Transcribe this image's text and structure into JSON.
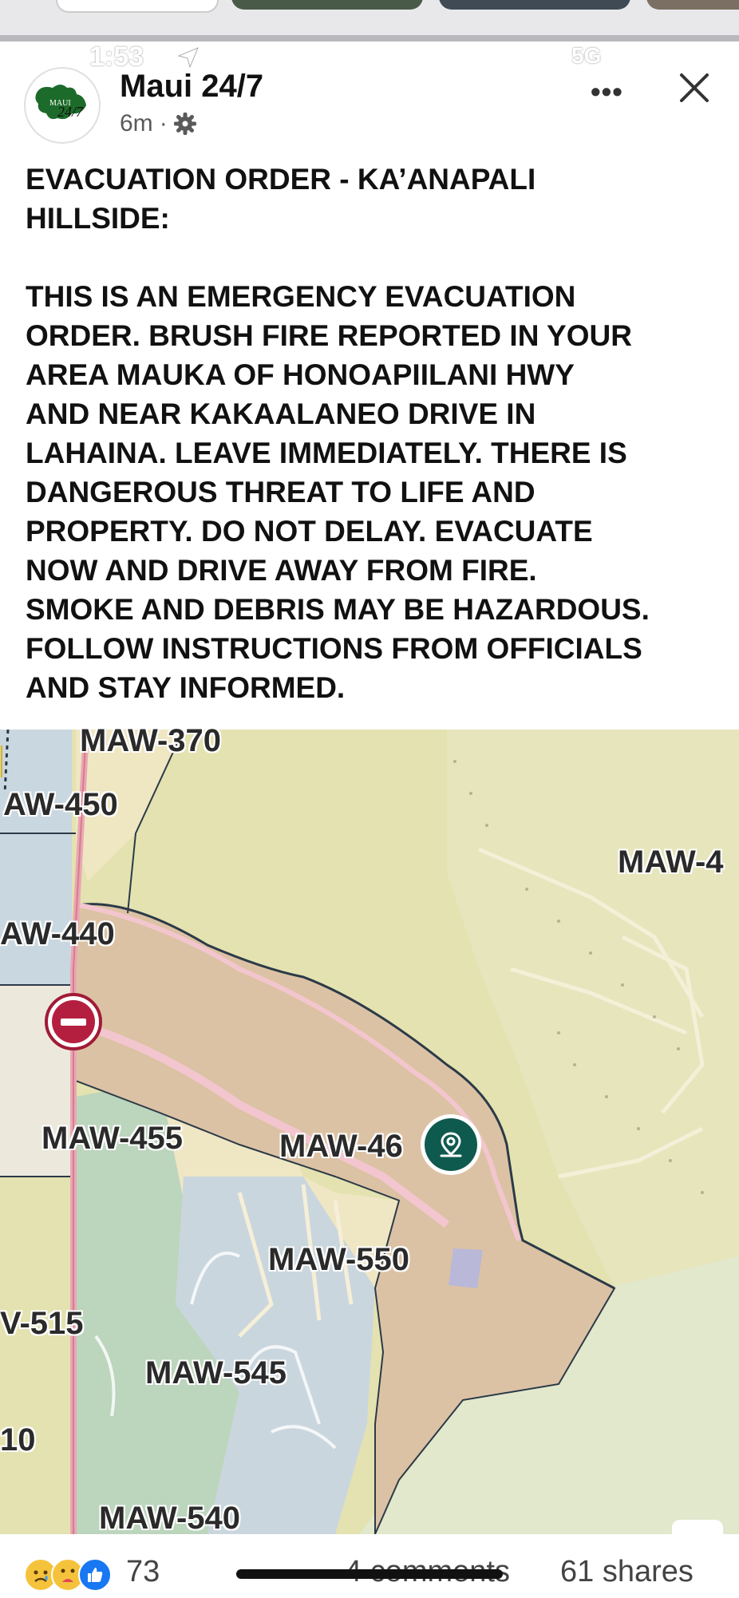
{
  "status_bar": {
    "time": "1:53",
    "network": "5G"
  },
  "post": {
    "page_name": "Maui 24/7",
    "avatar_text_top": "MAUI",
    "avatar_text_bottom": "24/7",
    "age": "6m",
    "separator": "·",
    "more_label": "•••",
    "title_line1": "EVACUATION ORDER - KA’ANAPALI",
    "title_line2": "HILLSIDE:",
    "body_lines": [
      "THIS IS AN EMERGENCY EVACUATION",
      "ORDER. BRUSH FIRE REPORTED IN YOUR",
      "AREA MAUKA OF HONOAPIILANI HWY",
      "AND NEAR KAKAALANEO DRIVE IN",
      "LAHAINA. LEAVE IMMEDIATELY. THERE IS",
      "DANGEROUS THREAT TO LIFE AND",
      "PROPERTY. DO NOT DELAY. EVACUATE",
      "NOW AND DRIVE AWAY FROM FIRE.",
      "SMOKE AND DEBRIS MAY BE HAZARDOUS.",
      "FOLLOW INSTRUCTIONS FROM OFFICIALS",
      "AND STAY INFORMED."
    ]
  },
  "map": {
    "zones": {
      "z370": "MAW-370",
      "z450": "AW-450",
      "z4": "MAW-4",
      "z440": "AW-440",
      "z455": "MAW-455",
      "z46": "MAW-46",
      "z550": "MAW-550",
      "z515": "V-515",
      "z545": "MAW-545",
      "z10": "10",
      "z540": "MAW-540"
    },
    "colors": {
      "evac_zone": "#dcc2a4",
      "warning_zone": "#e7e0a8",
      "residential": "#efe6c2",
      "blue_zone": "#c9d7e0",
      "green_zone": "#bfd6bf",
      "road": "#e9a7b3",
      "pin": "#0f5a4e",
      "no_entry": "#b51f3f"
    }
  },
  "footer": {
    "reaction_count": "73",
    "comments": "4 comments",
    "shares": "61 shares"
  }
}
